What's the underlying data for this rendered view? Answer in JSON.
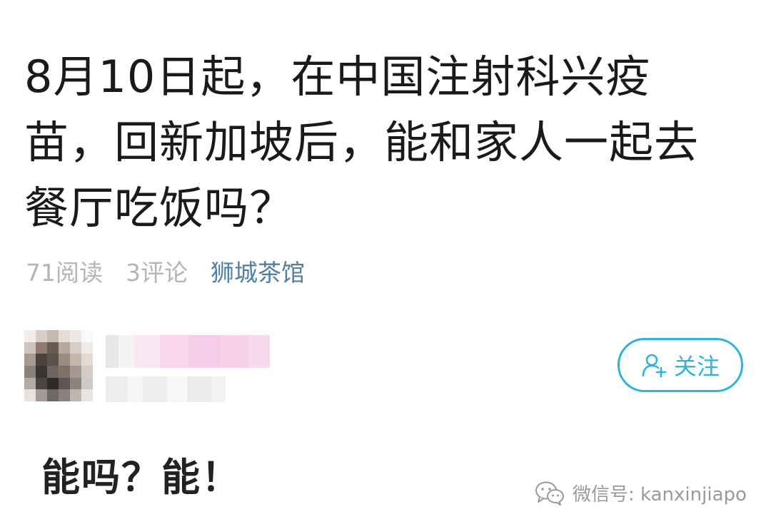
{
  "post": {
    "title": "8月10日起，在中国注射科兴疫苗，回新加坡后，能和家人一起去餐厅吃饭吗？",
    "views": "71阅读",
    "comments": "3评论",
    "channel": "狮城茶馆"
  },
  "author": {
    "follow_label": "关注",
    "follow_icon": "add-user-icon"
  },
  "answer": {
    "text": "能吗？能！"
  },
  "watermark": {
    "text": "微信号: kanxinjiapo",
    "icon": "wechat-icon"
  },
  "colors": {
    "accent": "#2db2e6",
    "channel": "#4f7fa8",
    "meta": "#b5b5b5",
    "title": "#1a1a1a"
  }
}
